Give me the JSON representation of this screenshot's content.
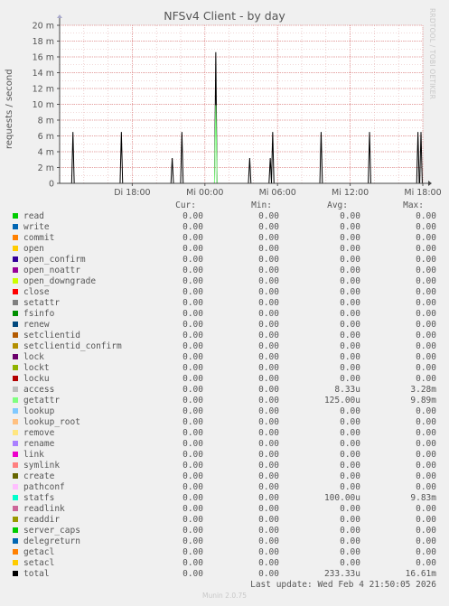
{
  "chart_data": {
    "type": "line",
    "title": "NFSv4 Client - by day",
    "ylabel": "requests / second",
    "ylim": [
      0,
      20
    ],
    "yticks": [
      {
        "v": 0,
        "label": "0"
      },
      {
        "v": 2,
        "label": "2 m"
      },
      {
        "v": 4,
        "label": "4 m"
      },
      {
        "v": 6,
        "label": "6 m"
      },
      {
        "v": 8,
        "label": "8 m"
      },
      {
        "v": 10,
        "label": "10 m"
      },
      {
        "v": 12,
        "label": "12 m"
      },
      {
        "v": 14,
        "label": "14 m"
      },
      {
        "v": 16,
        "label": "16 m"
      },
      {
        "v": 18,
        "label": "18 m"
      },
      {
        "v": 20,
        "label": "20 m"
      }
    ],
    "xlim": [
      12,
      42
    ],
    "xticks": [
      {
        "v": 18,
        "label": "Di 18:00"
      },
      {
        "v": 24,
        "label": "Mi 00:00"
      },
      {
        "v": 30,
        "label": "Mi 06:00"
      },
      {
        "v": 36,
        "label": "Mi 12:00"
      },
      {
        "v": 42,
        "label": "Mi 18:00"
      }
    ],
    "grid": true,
    "series": [
      {
        "name": "total",
        "color": "#000000",
        "x": [
          13.1,
          17.1,
          21.3,
          22.1,
          24.9,
          27.7,
          29.4,
          29.6,
          33.6,
          37.6,
          41.6,
          45.6
        ],
        "values": [
          6.5,
          6.5,
          3.2,
          6.5,
          16.6,
          3.2,
          3.2,
          6.5,
          6.5,
          6.5,
          6.5,
          6.5
        ]
      },
      {
        "name": "getattr",
        "color": "#80ff80",
        "x": [
          24.9
        ],
        "values": [
          9.9
        ]
      }
    ]
  },
  "side_text": "RRDTOOL / TOBI OETIKER",
  "legend_header": {
    "cur": "Cur:",
    "min": "Min:",
    "avg": "Avg:",
    "max": "Max:"
  },
  "legend": [
    {
      "name": "read",
      "color": "#00cc00",
      "cur": "0.00",
      "min": "0.00",
      "avg": "0.00",
      "max": "0.00"
    },
    {
      "name": "write",
      "color": "#0066b3",
      "cur": "0.00",
      "min": "0.00",
      "avg": "0.00",
      "max": "0.00"
    },
    {
      "name": "commit",
      "color": "#ff8000",
      "cur": "0.00",
      "min": "0.00",
      "avg": "0.00",
      "max": "0.00"
    },
    {
      "name": "open",
      "color": "#ffcc00",
      "cur": "0.00",
      "min": "0.00",
      "avg": "0.00",
      "max": "0.00"
    },
    {
      "name": "open_confirm",
      "color": "#330099",
      "cur": "0.00",
      "min": "0.00",
      "avg": "0.00",
      "max": "0.00"
    },
    {
      "name": "open_noattr",
      "color": "#990099",
      "cur": "0.00",
      "min": "0.00",
      "avg": "0.00",
      "max": "0.00"
    },
    {
      "name": "open_downgrade",
      "color": "#ccff00",
      "cur": "0.00",
      "min": "0.00",
      "avg": "0.00",
      "max": "0.00"
    },
    {
      "name": "close",
      "color": "#ff0000",
      "cur": "0.00",
      "min": "0.00",
      "avg": "0.00",
      "max": "0.00"
    },
    {
      "name": "setattr",
      "color": "#808080",
      "cur": "0.00",
      "min": "0.00",
      "avg": "0.00",
      "max": "0.00"
    },
    {
      "name": "fsinfo",
      "color": "#008f00",
      "cur": "0.00",
      "min": "0.00",
      "avg": "0.00",
      "max": "0.00"
    },
    {
      "name": "renew",
      "color": "#00487d",
      "cur": "0.00",
      "min": "0.00",
      "avg": "0.00",
      "max": "0.00"
    },
    {
      "name": "setclientid",
      "color": "#b35a00",
      "cur": "0.00",
      "min": "0.00",
      "avg": "0.00",
      "max": "0.00"
    },
    {
      "name": "setclientid_confirm",
      "color": "#b38f00",
      "cur": "0.00",
      "min": "0.00",
      "avg": "0.00",
      "max": "0.00"
    },
    {
      "name": "lock",
      "color": "#6b006b",
      "cur": "0.00",
      "min": "0.00",
      "avg": "0.00",
      "max": "0.00"
    },
    {
      "name": "lockt",
      "color": "#8fb300",
      "cur": "0.00",
      "min": "0.00",
      "avg": "0.00",
      "max": "0.00"
    },
    {
      "name": "locku",
      "color": "#b30000",
      "cur": "0.00",
      "min": "0.00",
      "avg": "0.00",
      "max": "0.00"
    },
    {
      "name": "access",
      "color": "#bebebe",
      "cur": "0.00",
      "min": "0.00",
      "avg": "8.33u",
      "max": "3.28m"
    },
    {
      "name": "getattr",
      "color": "#80ff80",
      "cur": "0.00",
      "min": "0.00",
      "avg": "125.00u",
      "max": "9.89m"
    },
    {
      "name": "lookup",
      "color": "#80c9ff",
      "cur": "0.00",
      "min": "0.00",
      "avg": "0.00",
      "max": "0.00"
    },
    {
      "name": "lookup_root",
      "color": "#ffc080",
      "cur": "0.00",
      "min": "0.00",
      "avg": "0.00",
      "max": "0.00"
    },
    {
      "name": "remove",
      "color": "#ffe680",
      "cur": "0.00",
      "min": "0.00",
      "avg": "0.00",
      "max": "0.00"
    },
    {
      "name": "rename",
      "color": "#aa80ff",
      "cur": "0.00",
      "min": "0.00",
      "avg": "0.00",
      "max": "0.00"
    },
    {
      "name": "link",
      "color": "#ee00cc",
      "cur": "0.00",
      "min": "0.00",
      "avg": "0.00",
      "max": "0.00"
    },
    {
      "name": "symlink",
      "color": "#ff8080",
      "cur": "0.00",
      "min": "0.00",
      "avg": "0.00",
      "max": "0.00"
    },
    {
      "name": "create",
      "color": "#666600",
      "cur": "0.00",
      "min": "0.00",
      "avg": "0.00",
      "max": "0.00"
    },
    {
      "name": "pathconf",
      "color": "#ffbfff",
      "cur": "0.00",
      "min": "0.00",
      "avg": "0.00",
      "max": "0.00"
    },
    {
      "name": "statfs",
      "color": "#00ffcc",
      "cur": "0.00",
      "min": "0.00",
      "avg": "100.00u",
      "max": "9.83m"
    },
    {
      "name": "readlink",
      "color": "#cc6699",
      "cur": "0.00",
      "min": "0.00",
      "avg": "0.00",
      "max": "0.00"
    },
    {
      "name": "readdir",
      "color": "#999900",
      "cur": "0.00",
      "min": "0.00",
      "avg": "0.00",
      "max": "0.00"
    },
    {
      "name": "server_caps",
      "color": "#00cc00",
      "cur": "0.00",
      "min": "0.00",
      "avg": "0.00",
      "max": "0.00"
    },
    {
      "name": "delegreturn",
      "color": "#0066b3",
      "cur": "0.00",
      "min": "0.00",
      "avg": "0.00",
      "max": "0.00"
    },
    {
      "name": "getacl",
      "color": "#ff8000",
      "cur": "0.00",
      "min": "0.00",
      "avg": "0.00",
      "max": "0.00"
    },
    {
      "name": "setacl",
      "color": "#ffcc00",
      "cur": "0.00",
      "min": "0.00",
      "avg": "0.00",
      "max": "0.00"
    },
    {
      "name": "total",
      "color": "#000000",
      "cur": "0.00",
      "min": "0.00",
      "avg": "233.33u",
      "max": "16.61m"
    }
  ],
  "last_update": "Last update: Wed Feb  4 21:50:05 2026",
  "version": "Munin 2.0.75"
}
